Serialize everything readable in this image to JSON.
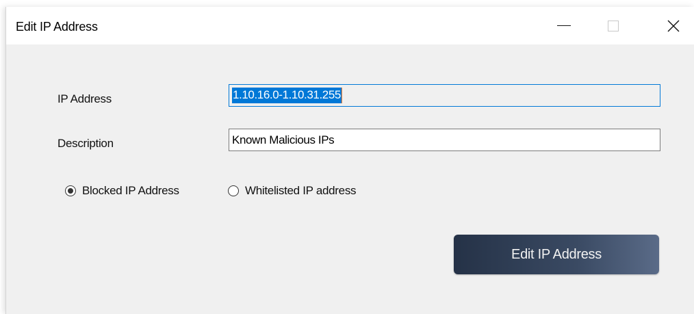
{
  "window": {
    "title": "Edit IP Address",
    "controls": {
      "minimize": "minimize-icon",
      "maximize": "maximize-icon",
      "close": "close-icon"
    }
  },
  "form": {
    "ip_label": "IP Address",
    "ip_value": "1.10.16.0-1.10.31.255",
    "description_label": "Description",
    "description_value": "Known Malicious IPs",
    "radio_options": [
      {
        "label": "Blocked IP Address",
        "selected": true
      },
      {
        "label": "Whitelisted IP address",
        "selected": false
      }
    ],
    "submit_label": "Edit IP Address"
  },
  "colors": {
    "window_background": "#f0f0f0",
    "titlebar_background": "#ffffff",
    "selection_highlight": "#0078d7",
    "button_gradient_start": "#253247",
    "button_gradient_end": "#5a6b88",
    "button_text": "#f2f2f2"
  }
}
